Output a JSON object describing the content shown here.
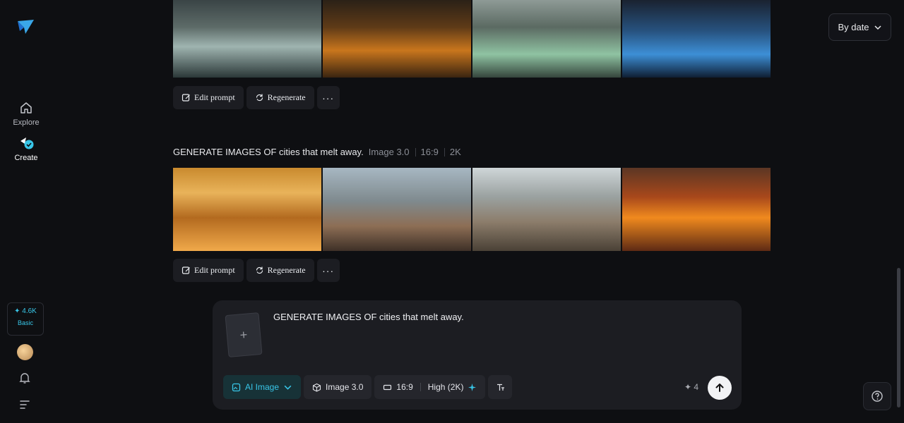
{
  "sidebar": {
    "items": [
      {
        "label": "Explore",
        "icon": "home-icon"
      },
      {
        "label": "Create",
        "icon": "create-icon"
      }
    ],
    "credits": {
      "amount": "✦ 4.6K",
      "plan": "Basic"
    }
  },
  "sort": {
    "label": "By date"
  },
  "actions": {
    "edit_label": "Edit prompt",
    "regenerate_label": "Regenerate",
    "more_label": "···"
  },
  "generation": {
    "prompt": "GENERATE IMAGES OF cities that melt away.",
    "model": "Image 3.0",
    "ratio": "16:9",
    "resolution": "2K"
  },
  "composer": {
    "upload_label": "+",
    "prompt_text": "GENERATE IMAGES OF cities that melt away.",
    "mode_label": "AI Image",
    "model_label": "Image 3.0",
    "ratio_label": "16:9",
    "quality_label": "High (2K)",
    "cost_label": "✦ 4"
  },
  "colors": {
    "accent": "#38c6e8",
    "background": "#0e0f12",
    "panel": "#1c1d22"
  }
}
